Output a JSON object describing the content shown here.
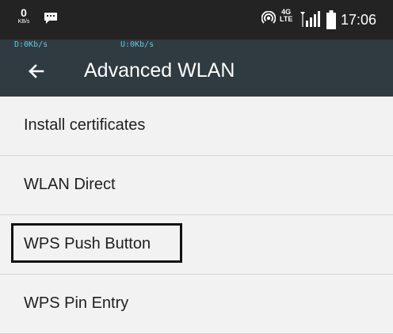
{
  "status_bar": {
    "kb_value": "0",
    "kb_unit": "KB/s",
    "network_top": "4G",
    "network_bottom": "LTE",
    "time": "17:06"
  },
  "speed_meter": {
    "download": "D:0Kb/s",
    "upload": "U:0Kb/s"
  },
  "app_bar": {
    "title": "Advanced WLAN"
  },
  "settings_list": {
    "items": [
      {
        "label": "Install certificates"
      },
      {
        "label": "WLAN Direct"
      },
      {
        "label": "WPS Push Button",
        "highlighted": true
      },
      {
        "label": "WPS Pin Entry"
      }
    ]
  },
  "colors": {
    "status_bar_bg": "#232323",
    "app_bar_bg": "#2f3b40",
    "speed_text": "#5ecde0",
    "list_bg": "#f2f2f2",
    "highlight_border": "#111111"
  },
  "icons": {
    "notification": "chat-bubble-icon",
    "hotspot": "hotspot-icon",
    "signal": "cell-signal-icon",
    "battery": "battery-icon",
    "back": "arrow-left-icon"
  }
}
